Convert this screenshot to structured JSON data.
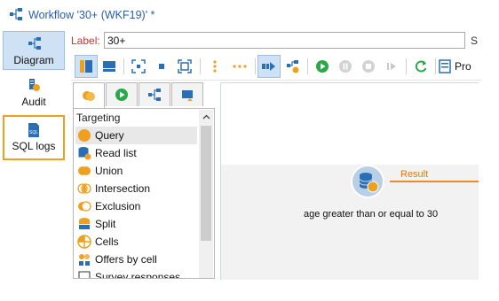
{
  "window": {
    "title": "Workflow '30+ (WKF19)' *"
  },
  "leftnav": {
    "items": [
      {
        "label": "Diagram",
        "icon": "diagram-icon"
      },
      {
        "label": "Audit",
        "icon": "audit-icon"
      },
      {
        "label": "SQL logs",
        "icon": "sql-logs-icon"
      }
    ]
  },
  "labelfield": {
    "label": "Label:",
    "value": "30+",
    "trailing": "S"
  },
  "toolbar": {
    "pro_label": "Pro"
  },
  "palette": {
    "header": "Targeting",
    "items": [
      {
        "label": "Query",
        "icon": "query-icon"
      },
      {
        "label": "Read list",
        "icon": "read-list-icon"
      },
      {
        "label": "Union",
        "icon": "union-icon"
      },
      {
        "label": "Intersection",
        "icon": "intersection-icon"
      },
      {
        "label": "Exclusion",
        "icon": "exclusion-icon"
      },
      {
        "label": "Split",
        "icon": "split-icon"
      },
      {
        "label": "Cells",
        "icon": "cells-icon"
      },
      {
        "label": "Offers by cell",
        "icon": "offers-by-cell-icon"
      },
      {
        "label": "Survey responses",
        "icon": "survey-responses-icon"
      }
    ]
  },
  "canvas": {
    "node_label": "age greater than or equal to 30",
    "transition_label": "Result"
  },
  "colors": {
    "accent": "#f0a020",
    "blue": "#2a6fb5",
    "green": "#2aa84a"
  }
}
